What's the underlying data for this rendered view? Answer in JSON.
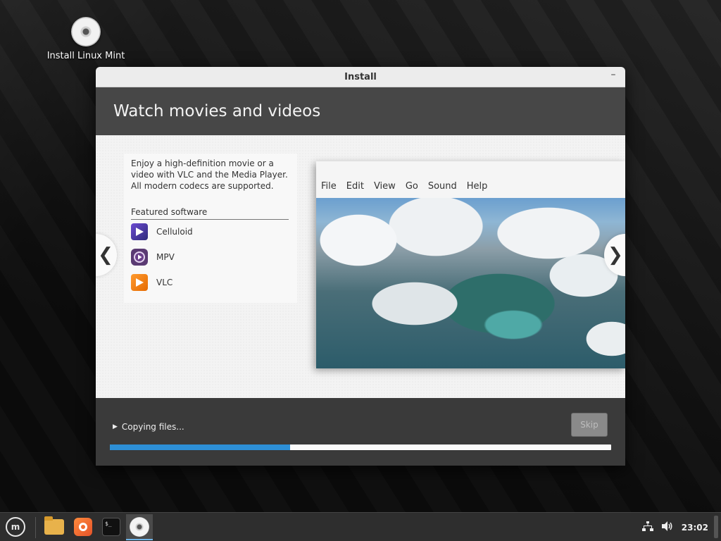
{
  "desktop": {
    "icon_label": "Install Linux Mint",
    "icon_name": "disc-icon"
  },
  "window": {
    "title": "Install",
    "minimize_label": "–"
  },
  "slide": {
    "title": "Watch movies and videos",
    "intro": "Enjoy a high-definition movie or a video with VLC and the Media Player. All modern codecs are supported.",
    "featured_heading": "Featured software",
    "apps": [
      {
        "name": "Celluloid",
        "icon": "celluloid-icon",
        "color": "#5a3ec0"
      },
      {
        "name": "MPV",
        "icon": "mpv-icon",
        "color": "#5a3a73"
      },
      {
        "name": "VLC",
        "icon": "vlc-icon",
        "color": "#f08a1c"
      }
    ],
    "prev_label": "❮",
    "next_label": "❯"
  },
  "player": {
    "menu": [
      "File",
      "Edit",
      "View",
      "Go",
      "Sound",
      "Help"
    ]
  },
  "bottom": {
    "status": "Copying files...",
    "skip_label": "Skip",
    "progress_fraction": 0.36,
    "progress_color": "#2d8fd6"
  },
  "taskbar": {
    "items": [
      "mint-menu-icon",
      "files-icon",
      "firefox-icon",
      "terminal-icon",
      "installer-disc-icon"
    ],
    "tray": [
      "network-icon",
      "volume-icon"
    ],
    "clock": "23:02"
  }
}
